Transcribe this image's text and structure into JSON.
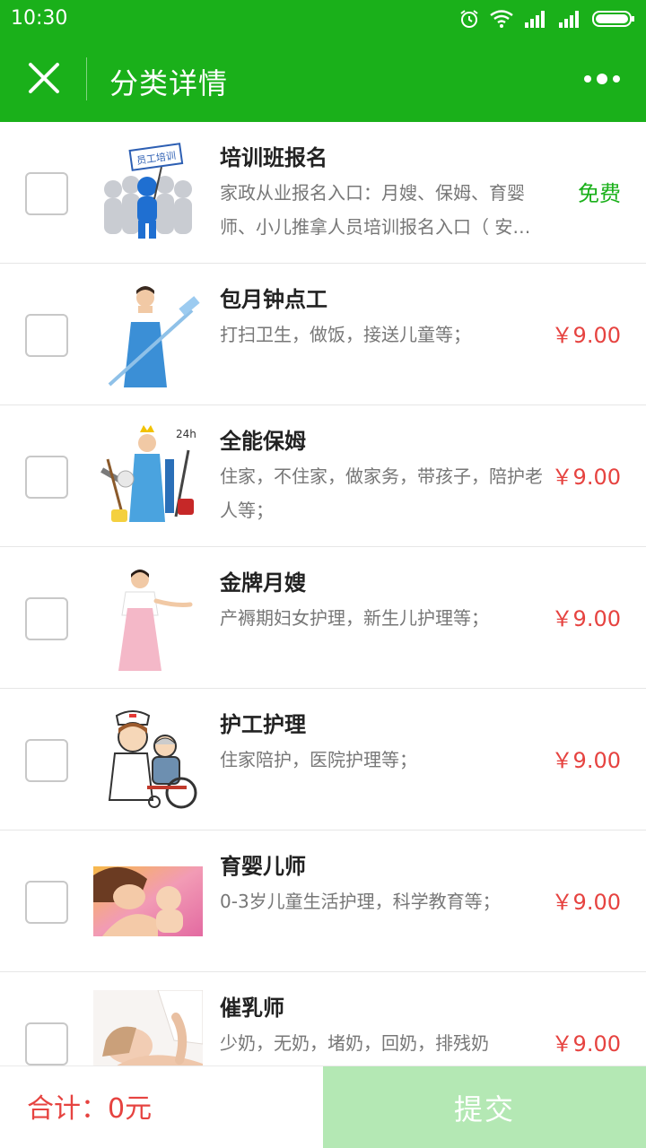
{
  "status_bar": {
    "time": "10:30"
  },
  "header": {
    "title": "分类详情"
  },
  "items": [
    {
      "title": "培训班报名",
      "desc": "家政从业报名入口：月嫂、保姆、育婴师、小儿推拿人员培训报名入口（ 安…",
      "price": "免费",
      "thumb_label": "员工培训"
    },
    {
      "title": "包月钟点工",
      "desc": "打扫卫生，做饭，接送儿童等；",
      "price": "￥9.00"
    },
    {
      "title": "全能保姆",
      "desc": "住家，不住家，做家务，带孩子，陪护老人等；",
      "price": "￥9.00",
      "thumb_label": "24h"
    },
    {
      "title": "金牌月嫂",
      "desc": "产褥期妇女护理，新生儿护理等；",
      "price": "￥9.00"
    },
    {
      "title": "护工护理",
      "desc": "住家陪护，医院护理等；",
      "price": "￥9.00"
    },
    {
      "title": "育婴儿师",
      "desc": "0-3岁儿童生活护理，科学教育等；",
      "price": "￥9.00"
    },
    {
      "title": "催乳师",
      "desc": "少奶，无奶，堵奶，回奶，排残奶",
      "price": "￥9.00"
    }
  ],
  "footer": {
    "total": "合计：0元",
    "submit_label": "提交"
  },
  "colors": {
    "brand": "#1ab01a",
    "price": "#e64340",
    "submit_disabled": "#b4e8b4"
  }
}
